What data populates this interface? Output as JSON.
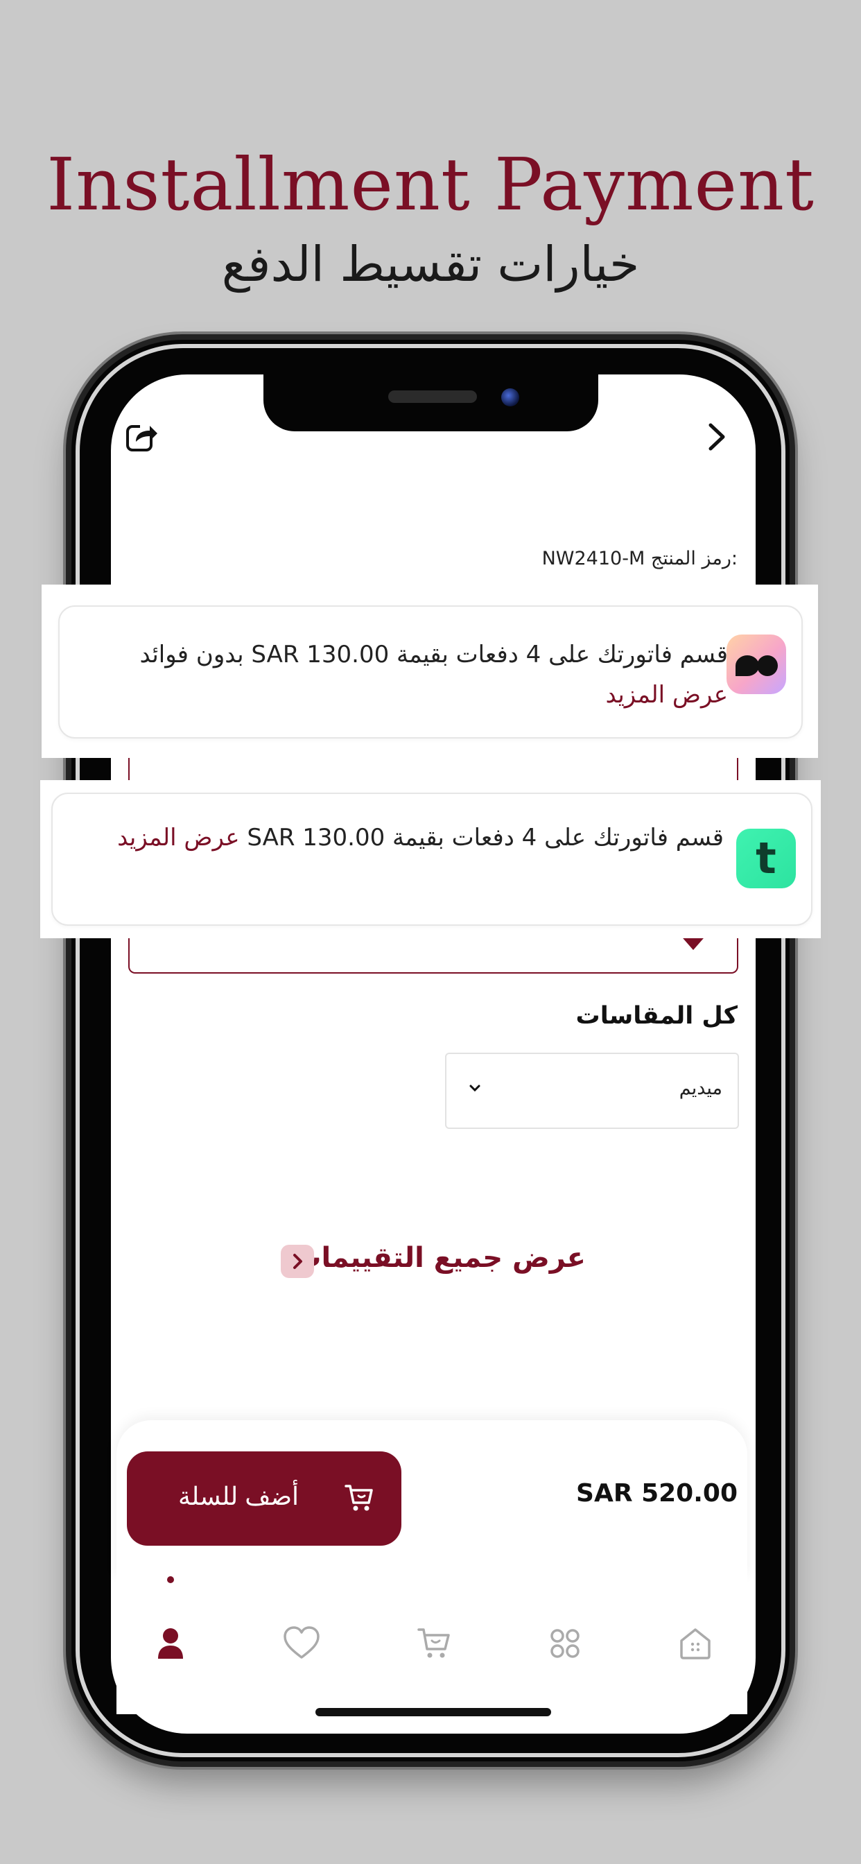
{
  "hero": {
    "title_en": "Installment Payment",
    "title_ar": "خيارات تقسيط الدفع"
  },
  "product": {
    "code_label": "رمز المنتج:",
    "code_value": "NW2410-M"
  },
  "installments": [
    {
      "provider_icon": "tabby-logo-icon",
      "text": "قسم فاتورتك على 4 دفعات بقيمة SAR 130.00 بدون فوائد",
      "more_label": "عرض المزيد"
    },
    {
      "provider_icon": "tamara-logo-icon",
      "logo_glyph": "t",
      "text": "قسم فاتورتك على 4 دفعات بقيمة SAR 130.00",
      "more_label": "عرض المزيد"
    }
  ],
  "sizes": {
    "label": "كل المقاسات",
    "selected": "ميديم"
  },
  "reviews": {
    "link_label": "عرض جميع التقييمات"
  },
  "buy": {
    "add_to_cart_label": "أضف للسلة",
    "price": "SAR 520.00"
  },
  "tabs": [
    {
      "name": "tab-profile",
      "icon": "user-icon",
      "active": true
    },
    {
      "name": "tab-wishlist",
      "icon": "heart-icon",
      "active": false
    },
    {
      "name": "tab-cart",
      "icon": "cart-icon",
      "active": false
    },
    {
      "name": "tab-categories",
      "icon": "grid-icon",
      "active": false
    },
    {
      "name": "tab-home",
      "icon": "home-icon",
      "active": false
    }
  ],
  "colors": {
    "brand": "#7a0f25",
    "background": "#c9c9c9",
    "tabby_gradient": "#f7a6c9",
    "tamara_green": "#3ff2b0"
  }
}
